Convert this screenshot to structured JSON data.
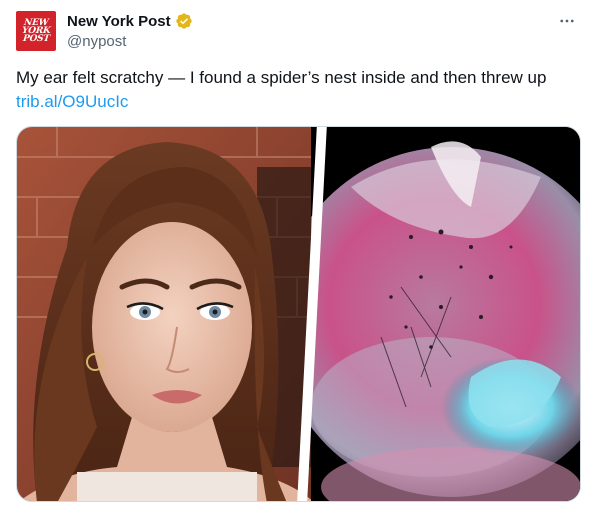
{
  "account": {
    "display_name": "New York Post",
    "handle": "@nypost",
    "avatar_logo_lines": [
      "NEW",
      "YORK",
      "POST"
    ],
    "verified_badge_color": "#e2b719",
    "avatar_color": "#d2232a"
  },
  "tweet": {
    "text": "My ear felt scratchy — I found a spider’s nest inside and then threw up",
    "link": "trib.al/O9UucIc"
  },
  "icons": {
    "more": "more-horizontal-icon",
    "verified": "verified-badge-icon"
  },
  "colors": {
    "text": "#0f1419",
    "secondary": "#536471",
    "link": "#1d9bf0"
  }
}
